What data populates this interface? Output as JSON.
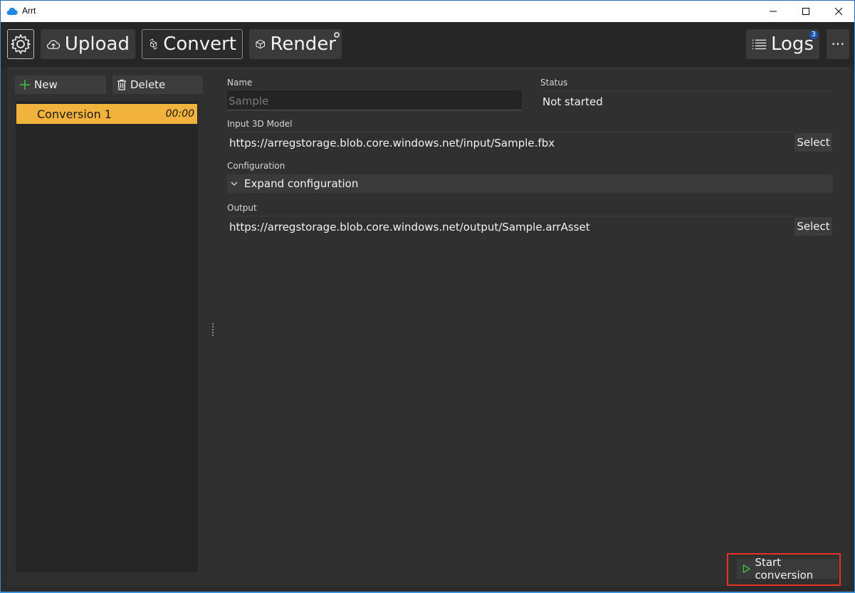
{
  "window": {
    "title": "Arrt"
  },
  "toolbar": {
    "upload_label": "Upload",
    "convert_label": "Convert",
    "render_label": "Render",
    "logs_label": "Logs",
    "logs_badge": "3",
    "more_label": "···",
    "active_tab": "Convert"
  },
  "conversions": {
    "new_label": "New",
    "delete_label": "Delete",
    "items": [
      {
        "name": "Conversion 1",
        "time": "00:00",
        "selected": true
      }
    ]
  },
  "form": {
    "name_label": "Name",
    "name_placeholder": "Sample",
    "status_label": "Status",
    "status_value": "Not started",
    "input_label": "Input 3D Model",
    "input_value": "https://arregstorage.blob.core.windows.net/input/Sample.fbx",
    "input_select_label": "Select",
    "config_label": "Configuration",
    "expand_config_label": "Expand configuration",
    "output_label": "Output",
    "output_value": "https://arregstorage.blob.core.windows.net/output/Sample.arrAsset",
    "output_select_label": "Select",
    "start_label": "Start conversion"
  },
  "colors": {
    "selected_item": "#f2b33d",
    "highlight": "#e8321e",
    "play_icon": "#3fc43f",
    "new_icon": "#3fc43f"
  },
  "icons": {
    "app": "cloud-icon",
    "settings": "gear-icon",
    "upload": "cloud-upload-icon",
    "convert": "cube-convert-icon",
    "render": "cube-icon",
    "logs": "list-icon",
    "new": "plus-icon",
    "delete": "trash-icon",
    "expand": "chevron-down-icon",
    "start": "play-icon"
  }
}
